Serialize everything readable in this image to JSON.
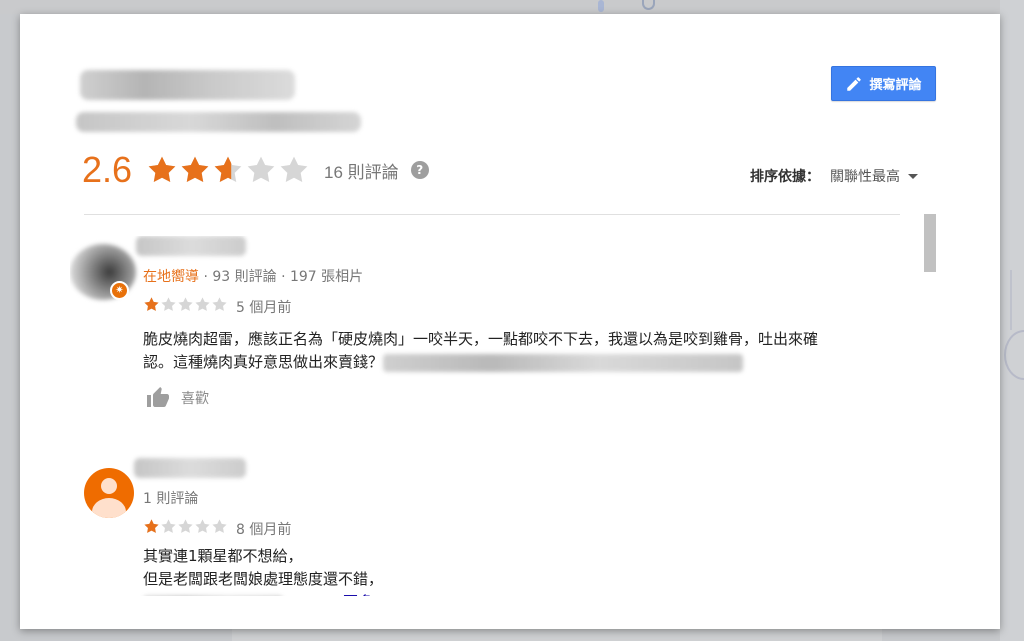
{
  "header": {
    "write_review_label": "撰寫評論",
    "rating_value": "2.6",
    "rating_stars": 2.6,
    "review_count": "16 則評論",
    "help_icon": "help-circle-icon",
    "sort_label": "排序依據：",
    "sort_value": "關聯性最高"
  },
  "colors": {
    "accent_orange": "#e7711b",
    "button_blue": "#4285f4",
    "star_empty": "#d6d6d6"
  },
  "reviews": [
    {
      "badge": "在地嚮導",
      "meta_rest": "· 93 則評論 · 197 張相片",
      "stars": 1,
      "time": "5 個月前",
      "text_line1": "脆皮燒肉超雷，應該正名為「硬皮燒肉」一咬半天，一點都咬不下去，我還以為是咬到雞骨，吐出來確",
      "text_line2": "認。這種燒肉真好意思做出來賣錢？",
      "like_label": "喜歡"
    },
    {
      "meta_rest": "1 則評論",
      "stars": 1,
      "time": "8 個月前",
      "text_line1": "其實連1顆星都不想給，",
      "text_line2": "但是老闆跟老闆娘處理態度還不錯，",
      "more_label": "更多"
    }
  ]
}
